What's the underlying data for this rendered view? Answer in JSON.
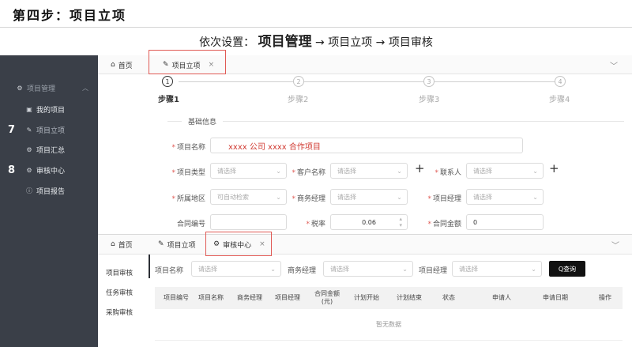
{
  "page": {
    "step_title": "第四步：项目立项",
    "subtitle_prefix": "依次设置：",
    "subtitle_strong": "项目管理",
    "subtitle_path": "→ 项目立项 → 项目审核"
  },
  "sidebar": {
    "group_label": "项目管理",
    "items": [
      {
        "label": "我的项目",
        "icon": "briefcase-icon"
      },
      {
        "label": "项目立项",
        "icon": "pin-icon",
        "number": "7"
      },
      {
        "label": "项目汇总",
        "icon": "gear-icon"
      },
      {
        "label": "审核中心",
        "icon": "gear-icon",
        "number": "8"
      },
      {
        "label": "项目报告",
        "icon": "info-icon"
      }
    ]
  },
  "top_tabs": [
    {
      "label": "首页",
      "icon": "home-icon"
    },
    {
      "label": "项目立项",
      "icon": "pin-icon",
      "close": "×"
    }
  ],
  "steps": [
    {
      "number": "1",
      "label": "步骤1",
      "active": true
    },
    {
      "number": "2",
      "label": "步骤2",
      "active": false
    },
    {
      "number": "3",
      "label": "步骤3",
      "active": false
    },
    {
      "number": "4",
      "label": "步骤4",
      "active": false
    }
  ],
  "form": {
    "section_title": "基础信息",
    "project_name": {
      "label": "项目名称",
      "value": "xxxx 公司 xxxx 合作项目"
    },
    "project_type": {
      "label": "项目类型",
      "placeholder": "请选择"
    },
    "customer_name": {
      "label": "客户名称",
      "placeholder": "请选择"
    },
    "contact": {
      "label": "联系人",
      "placeholder": "请选择"
    },
    "region": {
      "label": "所属地区",
      "placeholder": "可自动检索"
    },
    "business_manager": {
      "label": "商务经理",
      "placeholder": "请选择"
    },
    "project_manager": {
      "label": "项目经理",
      "placeholder": "请选择"
    },
    "contract_no": {
      "label": "合同编号",
      "value": ""
    },
    "tax_rate": {
      "label": "税率",
      "value": "0.06"
    },
    "contract_amount": {
      "label": "合同金额",
      "value": "0"
    },
    "plus": "+"
  },
  "bottom_tabs": [
    {
      "label": "首页",
      "icon": "home-icon"
    },
    {
      "label": "项目立项",
      "icon": "pin-icon"
    },
    {
      "label": "审核中心",
      "icon": "gear-icon",
      "close": "×"
    }
  ],
  "sub_nav": [
    "项目审核",
    "任务审核",
    "采购审核"
  ],
  "filters": {
    "project_name": {
      "label": "项目名称",
      "placeholder": "请选择"
    },
    "business_manager": {
      "label": "商务经理",
      "placeholder": "请选择"
    },
    "project_manager": {
      "label": "项目经理",
      "placeholder": "请选择"
    },
    "query_button": "Q查询"
  },
  "table": {
    "headers": [
      "项目编号",
      "项目名称",
      "商务经理",
      "项目经理",
      "合同金额(元)",
      "计划开始",
      "计划结束",
      "状态",
      "申请人",
      "申请日期",
      "操作"
    ],
    "empty_text": "暂无数据"
  },
  "colors": {
    "sidebar_bg": "#3a3f48",
    "highlight_red": "#e05a55",
    "required_star": "#e05a55",
    "query_button_bg": "#111111"
  }
}
